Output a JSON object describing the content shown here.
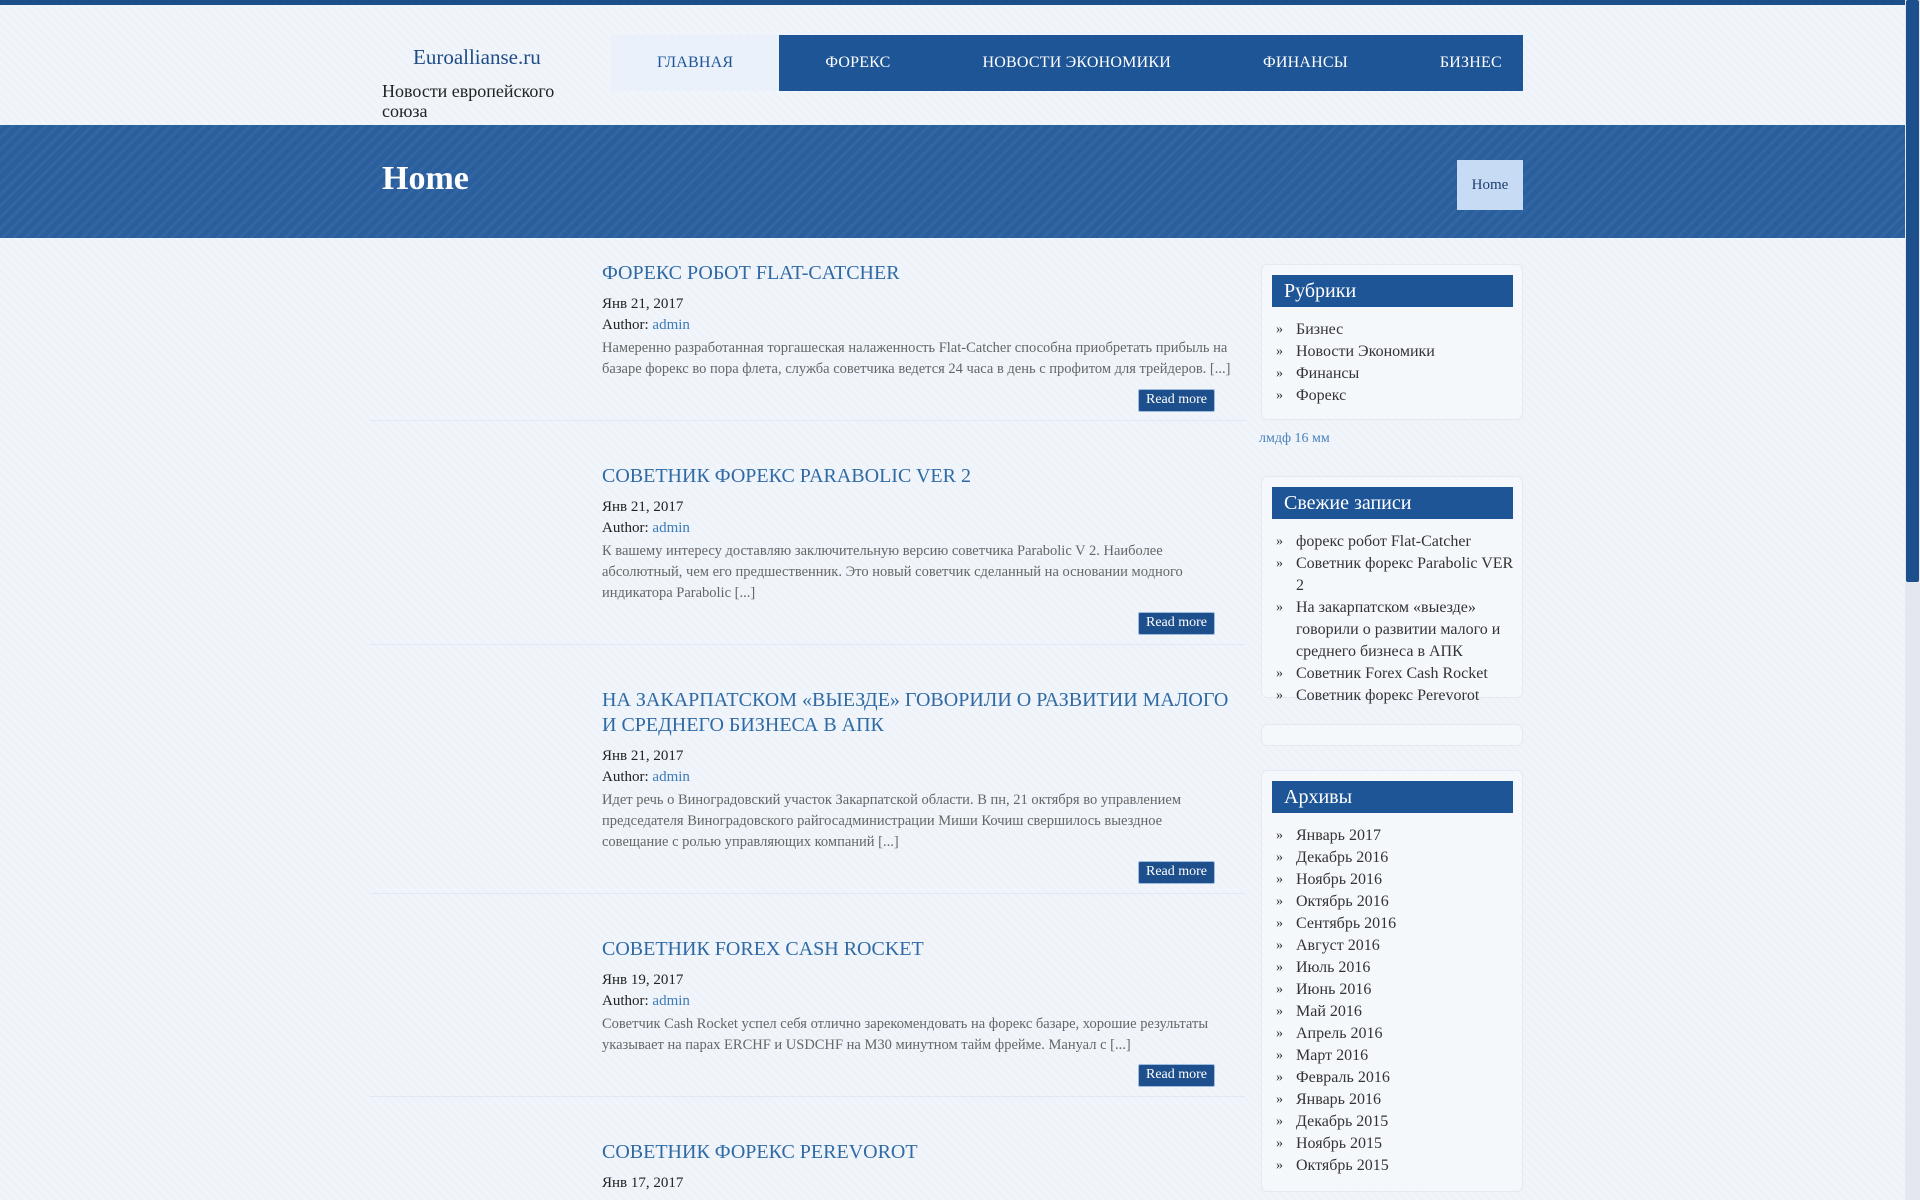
{
  "site": {
    "title": "Euroallianse.ru",
    "tagline": "Новости европейского союза"
  },
  "nav": {
    "items": [
      {
        "label": "Главная",
        "active": true
      },
      {
        "label": "Форекс",
        "active": false
      },
      {
        "label": "Новости Экономики",
        "active": false
      },
      {
        "label": "Финансы",
        "active": false
      },
      {
        "label": "Бизнес",
        "active": false
      }
    ]
  },
  "banner": {
    "heading": "Home",
    "breadcrumb": "Home"
  },
  "posts": [
    {
      "title": "форекс робот Flat-Catcher",
      "date": "Янв 21, 2017",
      "author_label": "Author:",
      "author": "admin",
      "excerpt": "Намеренно разработанная торгашеская налаженность Flat-Catcher способна приобретать прибыль на базаре форекс во пора флета, служба советчика ведется 24 часа в день с профитом для трейдеров. [...]",
      "read_more": "Read more"
    },
    {
      "title": "Советник форекс Parabolic VER 2",
      "date": "Янв 21, 2017",
      "author_label": "Author:",
      "author": "admin",
      "excerpt": "К вашему интересу доставляю заключительную версию советчика Parabolic V 2. Наиболее абсолютный, чем его предшественник.    Это новый советчик сделанный на основании модного индикатора Parabolic [...]",
      "read_more": "Read more"
    },
    {
      "title": "На закарпатском «выезде» говорили о развитии малого и среднего бизнеса в АПК",
      "date": "Янв 21, 2017",
      "author_label": "Author:",
      "author": "admin",
      "excerpt": "Идет речь о Виноградовский участок Закарпатской области. В пн, 21 октября во управлением председателя Виноградовского райгосадминистрации Миши Кочиш свершилось выездное совещание с ролью управляющих компаний [...]",
      "read_more": "Read more"
    },
    {
      "title": "Советник Forex Cash Rocket",
      "date": "Янв 19, 2017",
      "author_label": "Author:",
      "author": "admin",
      "excerpt": "Советчик Cash Rocket  успел себя отлично зарекомендовать на форекс базаре, хорошие результаты указывает на парах ERCHF и USDCHF на M30 минутном тайм фрейме. Мануал с [...]",
      "read_more": "Read more"
    },
    {
      "title": "Советник форекс Perevorot",
      "date": "Янв 17, 2017",
      "author_label": "",
      "author": "",
      "excerpt": "",
      "read_more": ""
    }
  ],
  "sidebar": {
    "categories": {
      "title": "Рубрики",
      "items": [
        "Бизнес",
        "Новости Экономики",
        "Финансы",
        "Форекс"
      ]
    },
    "link_text": "лмдф 16 мм",
    "recent": {
      "title": "Свежие записи",
      "items": [
        "форекс робот Flat-Catcher",
        "Советник форекс Parabolic VER 2",
        "На закарпатском «выезде» говорили о развитии малого и среднего бизнеса в АПК",
        "Советник Forex Cash Rocket",
        "Советник форекс Perevorot"
      ]
    },
    "archives": {
      "title": "Архивы",
      "items": [
        "Январь 2017",
        "Декабрь 2016",
        "Ноябрь 2016",
        "Октябрь 2016",
        "Сентябрь 2016",
        "Август 2016",
        "Июль 2016",
        "Июнь 2016",
        "Май 2016",
        "Апрель 2016",
        "Март 2016",
        "Февраль 2016",
        "Январь 2016",
        "Декабрь 2015",
        "Ноябрь 2015",
        "Октябрь 2015"
      ]
    }
  },
  "icons": {
    "list_bullet": "double-chevron-right-icon"
  },
  "colors": {
    "brand": "#1d5596",
    "banner": "#2a5f9e",
    "link": "#2f6aa4"
  }
}
